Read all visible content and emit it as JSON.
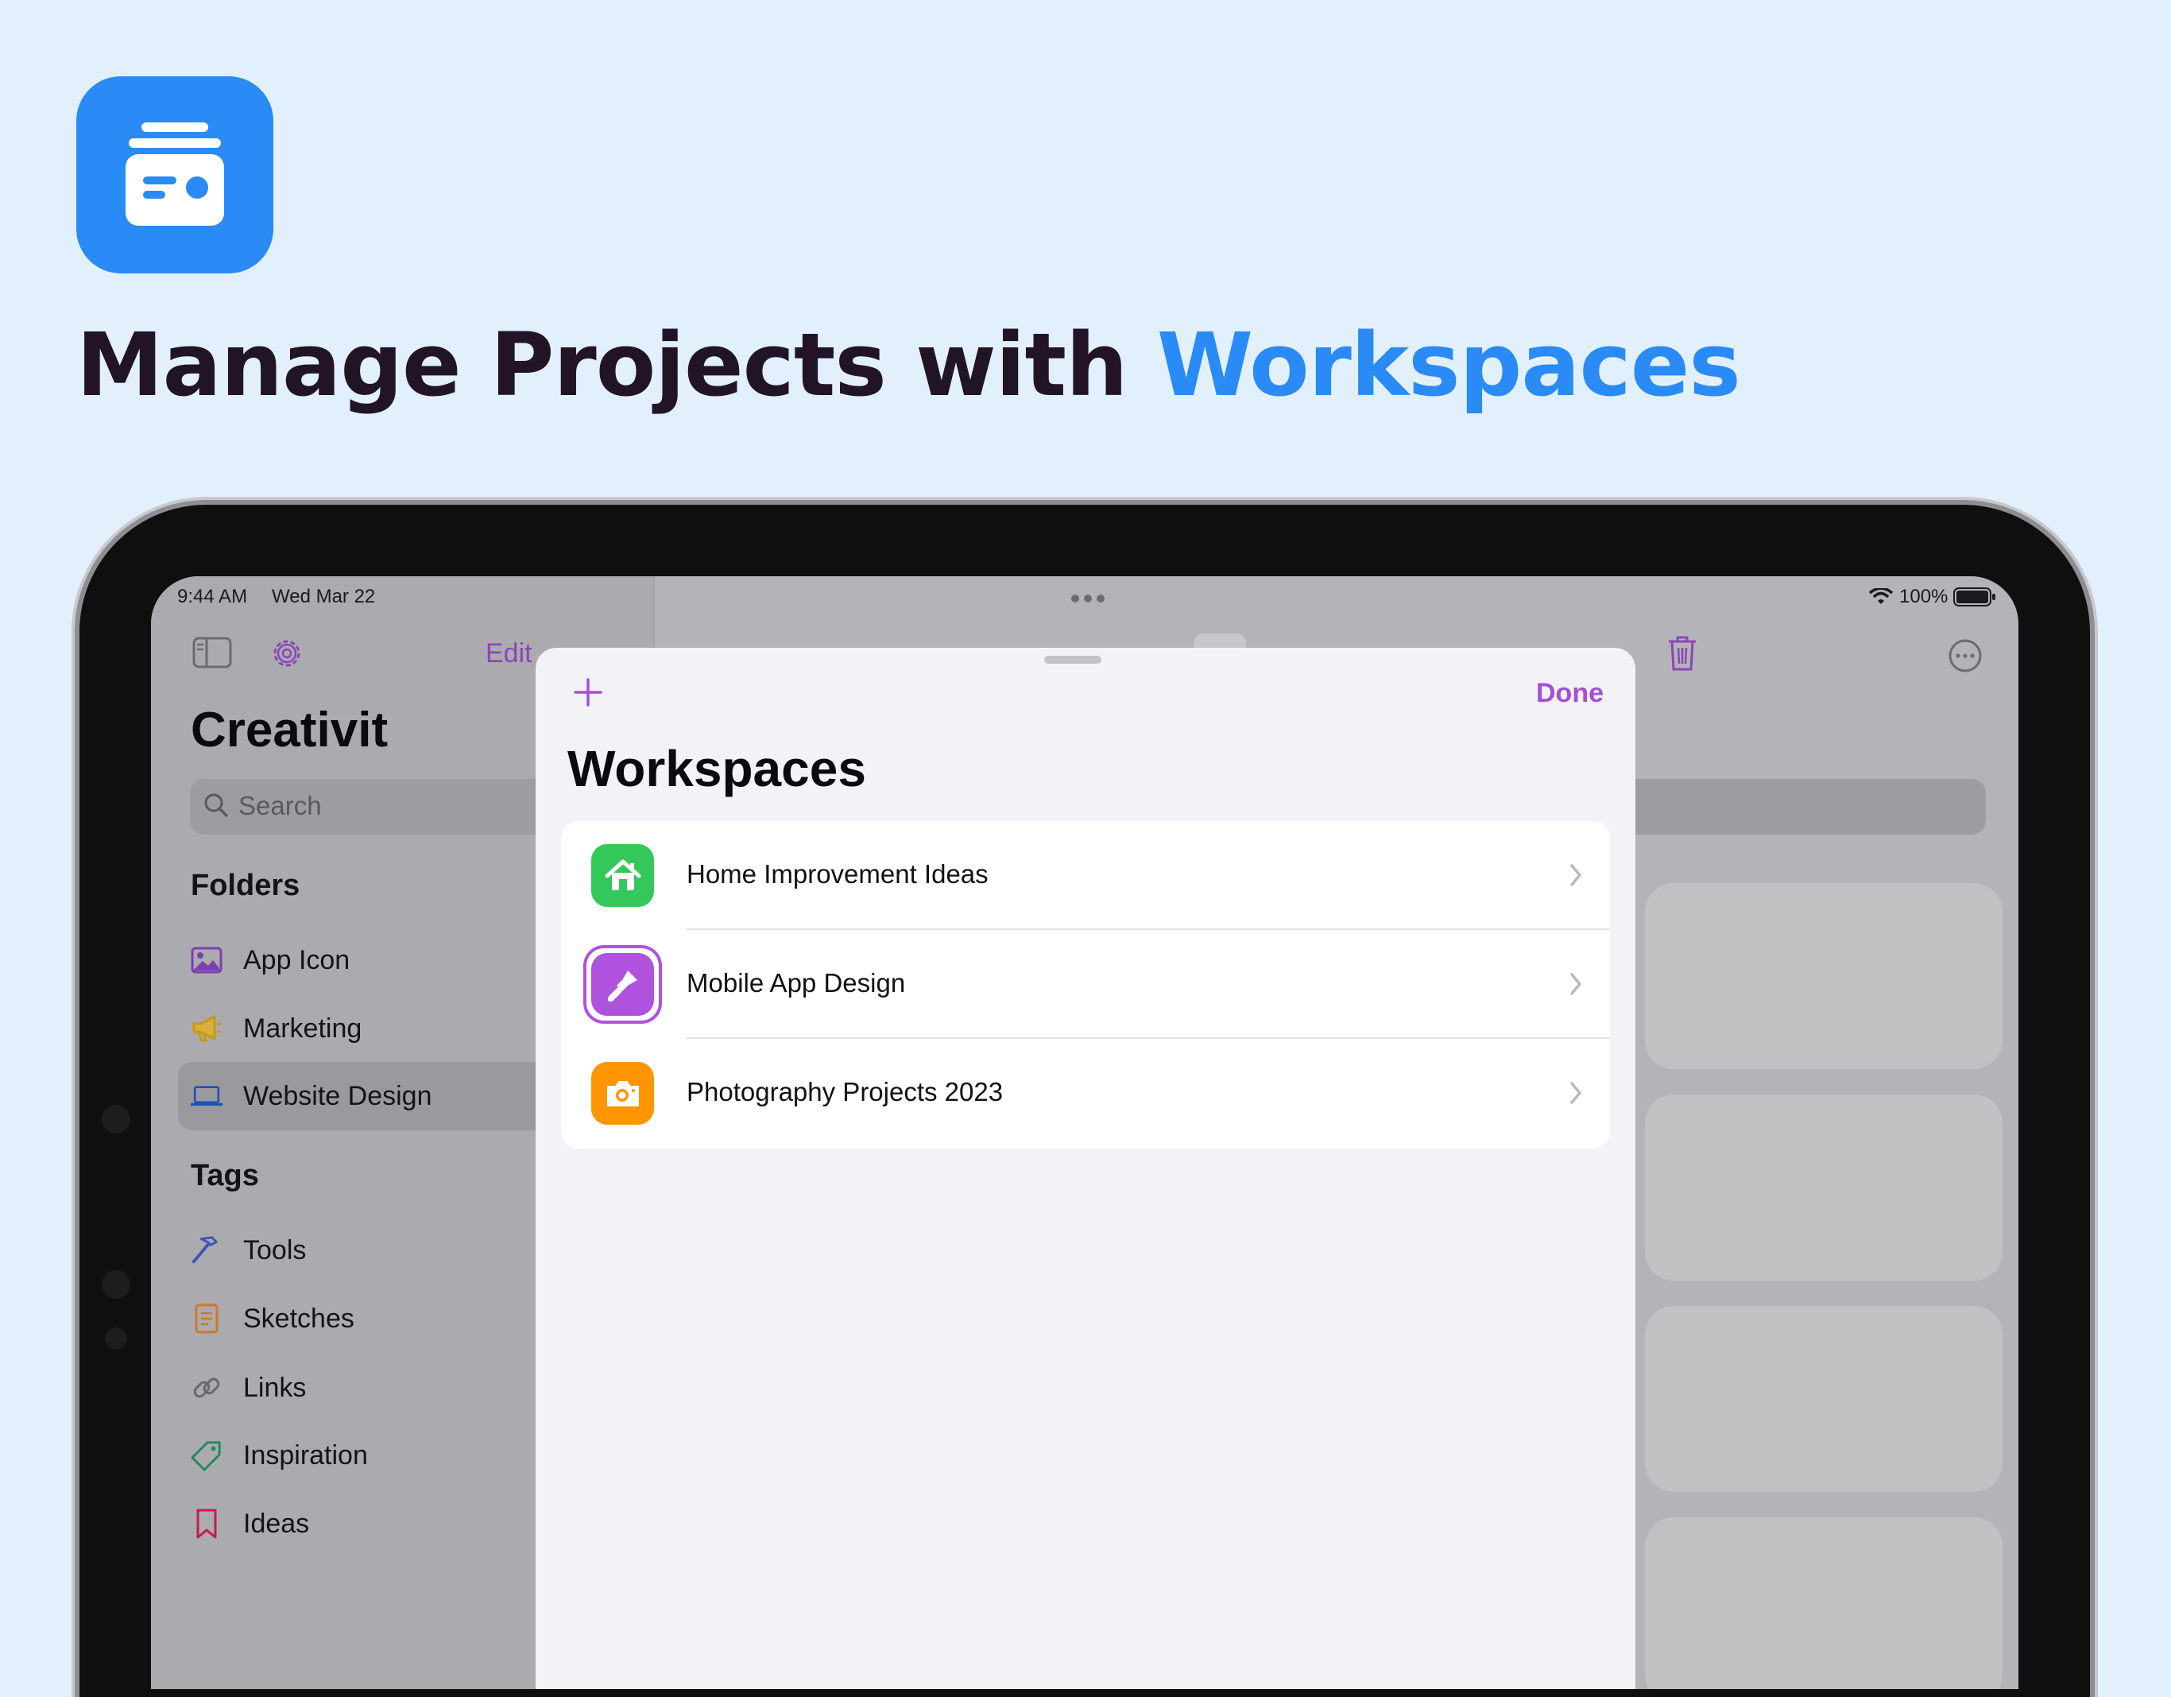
{
  "headline": {
    "prefix": "Manage Projects with ",
    "accent": "Workspaces"
  },
  "status_bar": {
    "time": "9:44 AM",
    "date": "Wed Mar 22",
    "battery": "100%"
  },
  "sidebar": {
    "edit_label": "Edit",
    "title": "Creativit",
    "search_placeholder": "Search",
    "folders_header": "Folders",
    "folders": [
      {
        "label": "App Icon",
        "icon": "photo-icon"
      },
      {
        "label": "Marketing",
        "icon": "megaphone-icon"
      },
      {
        "label": "Website Design",
        "icon": "laptop-icon"
      }
    ],
    "tags_header": "Tags",
    "tags": [
      {
        "label": "Tools",
        "icon": "hammer-icon"
      },
      {
        "label": "Sketches",
        "icon": "notepad-icon"
      },
      {
        "label": "Links",
        "icon": "link-icon"
      },
      {
        "label": "Inspiration",
        "icon": "tag-icon"
      },
      {
        "label": "Ideas",
        "icon": "bookmark-icon"
      }
    ]
  },
  "modal": {
    "title": "Workspaces",
    "done_label": "Done",
    "add_icon": "plus-icon",
    "workspaces": [
      {
        "label": "Home Improvement Ideas",
        "icon": "house-icon",
        "color": "#34c759"
      },
      {
        "label": "Mobile App Design",
        "icon": "paintbrush-icon",
        "color": "#af52de"
      },
      {
        "label": "Photography Projects 2023",
        "icon": "camera-icon",
        "color": "#ff9500"
      }
    ]
  },
  "colors": {
    "accent": "#2a8af6",
    "tint": "#a350d6",
    "headline": "#221427",
    "background": "#e2f0fd"
  }
}
